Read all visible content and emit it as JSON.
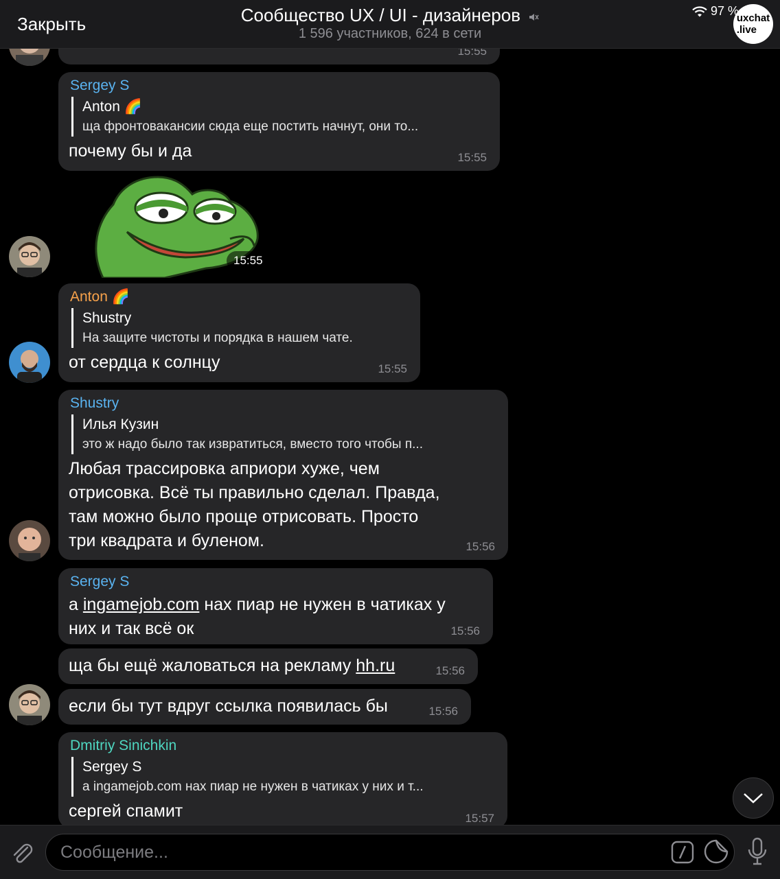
{
  "header": {
    "close_label": "Закрыть",
    "title": "Сообщество UX / UI - дизайнеров",
    "subtitle": "1 596 участников, 624 в сети",
    "battery": "97 %",
    "watermark_line1": "uxchat",
    "watermark_line2": ".live"
  },
  "messages": [
    {
      "time": "15:55"
    },
    {
      "sender": "Sergey S",
      "sender_color": "#5ab3f0",
      "reply_name": "Anton 🌈",
      "reply_text": "ща фронтовакансии сюда еще постить начнут, они то...",
      "text": "почему бы и да",
      "time": "15:55"
    },
    {
      "type": "sticker",
      "time": "15:55"
    },
    {
      "sender": "Anton 🌈",
      "sender_color": "#f7a24b",
      "reply_name": "Shustry",
      "reply_text": "На защите чистоты и порядка в нашем чате.",
      "text": "от сердца к солнцу",
      "time": "15:55"
    },
    {
      "sender": "Shustry",
      "sender_color": "#5ab3f0",
      "reply_name": "Илья Кузин",
      "reply_text": "это ж надо было так извратиться, вместо того чтобы п...",
      "text_lines": [
        "Любая трассировка априори хуже, чем",
        "отрисовка. Всё ты правильно сделал. Правда,",
        "там можно было проще отрисовать. Просто",
        "три квадрата и буленом."
      ],
      "time": "15:56"
    },
    {
      "sender": "Sergey S",
      "sender_color": "#5ab3f0",
      "text_pre": "а ",
      "link": "ingamejob.com",
      "text_post": " нах пиар не нужен в чатиках у",
      "text_line2": "них и так всё ок",
      "time": "15:56"
    },
    {
      "text_pre": "ща бы ещё жаловаться на рекламу ",
      "link": "hh.ru",
      "time": "15:56"
    },
    {
      "text": "если бы тут вдруг ссылка появилась бы",
      "time": "15:56"
    },
    {
      "sender": "Dmitriy Sinichkin",
      "sender_color": "#4fd6c0",
      "reply_name": "Sergey S",
      "reply_text": "а ingamejob.com нах пиар не нужен в чатиках у них и т...",
      "text": "сергей спамит",
      "time": "15:57"
    }
  ],
  "input": {
    "placeholder": "Сообщение..."
  }
}
